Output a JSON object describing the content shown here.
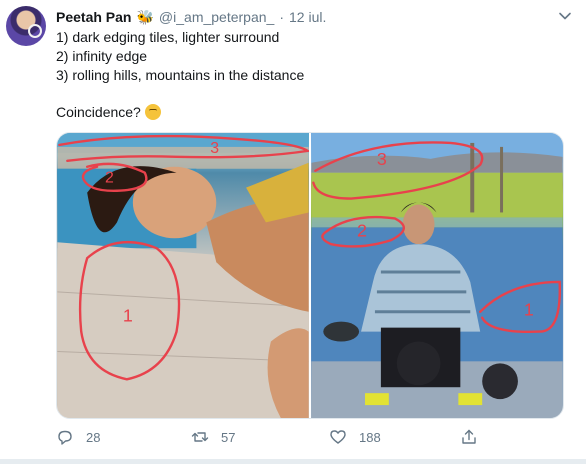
{
  "tweet": {
    "author_name": "Peetah Pan",
    "badge_icon": "bee-emoji-icon",
    "handle": "@i_am_peterpan_",
    "separator": "·",
    "date": "12 iul.",
    "lines": [
      "1) dark edging tiles, lighter surround",
      "2) infinity edge",
      "3) rolling hills, mountains in the distance"
    ],
    "closing": "Coincidence?",
    "closing_emoji": "thinking-face-emoji-icon"
  },
  "media": {
    "left_annotations": [
      "3",
      "2",
      "1"
    ],
    "right_annotations": [
      "3",
      "2",
      "1"
    ],
    "annotation_color": "#e8424c"
  },
  "actions": {
    "reply_count": "28",
    "retweet_count": "57",
    "like_count": "188"
  },
  "colors": {
    "text_primary": "#14171a",
    "text_secondary": "#657786",
    "border": "#e1e8ed"
  }
}
